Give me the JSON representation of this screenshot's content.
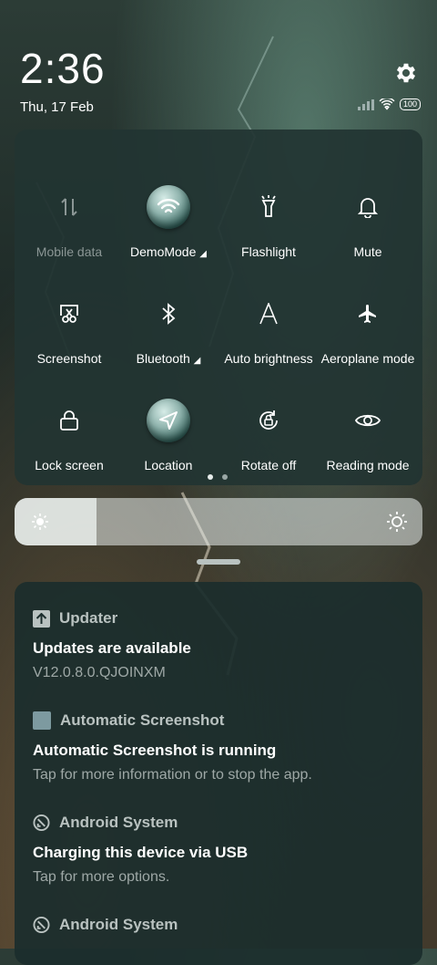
{
  "status": {
    "time": "2:36",
    "date": "Thu, 17 Feb",
    "battery": "100",
    "settings_icon": "gear-icon"
  },
  "tiles": [
    {
      "id": "mobile-data",
      "label": "Mobile data",
      "icon": "mobile-data-icon",
      "state": "disabled"
    },
    {
      "id": "wifi",
      "label": "DemoMode",
      "icon": "wifi-icon",
      "state": "on",
      "expandable": true
    },
    {
      "id": "flashlight",
      "label": "Flashlight",
      "icon": "flashlight-icon",
      "state": "off"
    },
    {
      "id": "mute",
      "label": "Mute",
      "icon": "bell-icon",
      "state": "off"
    },
    {
      "id": "screenshot",
      "label": "Screenshot",
      "icon": "scissors-icon",
      "state": "off"
    },
    {
      "id": "bluetooth",
      "label": "Bluetooth",
      "icon": "bluetooth-icon",
      "state": "off",
      "expandable": true
    },
    {
      "id": "auto-brightness",
      "label": "Auto brightness",
      "icon": "auto-brightness-icon",
      "state": "off"
    },
    {
      "id": "aeroplane",
      "label": "Aeroplane mode",
      "icon": "airplane-icon",
      "state": "off"
    },
    {
      "id": "lock-screen",
      "label": "Lock screen",
      "icon": "lock-icon",
      "state": "off"
    },
    {
      "id": "location",
      "label": "Location",
      "icon": "location-icon",
      "state": "on"
    },
    {
      "id": "rotate",
      "label": "Rotate off",
      "icon": "rotate-lock-icon",
      "state": "off"
    },
    {
      "id": "reading",
      "label": "Reading mode",
      "icon": "eye-icon",
      "state": "off"
    }
  ],
  "pager": {
    "pages": 2,
    "current": 1
  },
  "brightness": {
    "level": 0.2
  },
  "notifications": [
    {
      "app": "Updater",
      "icon": "updater-icon",
      "title": "Updates are available",
      "text": "V12.0.8.0.QJOINXM"
    },
    {
      "app": "Automatic Screenshot",
      "icon": "app-square-icon",
      "title": "Automatic Screenshot is running",
      "text": "Tap for more information or to stop the app."
    },
    {
      "app": "Android System",
      "icon": "android-system-icon",
      "title": "Charging this device via USB",
      "text": "Tap for more options."
    },
    {
      "app": "Android System",
      "icon": "android-system-icon",
      "title": "",
      "text": ""
    }
  ],
  "colors": {
    "panel": "#223432",
    "accent": "#8fb3ad"
  }
}
